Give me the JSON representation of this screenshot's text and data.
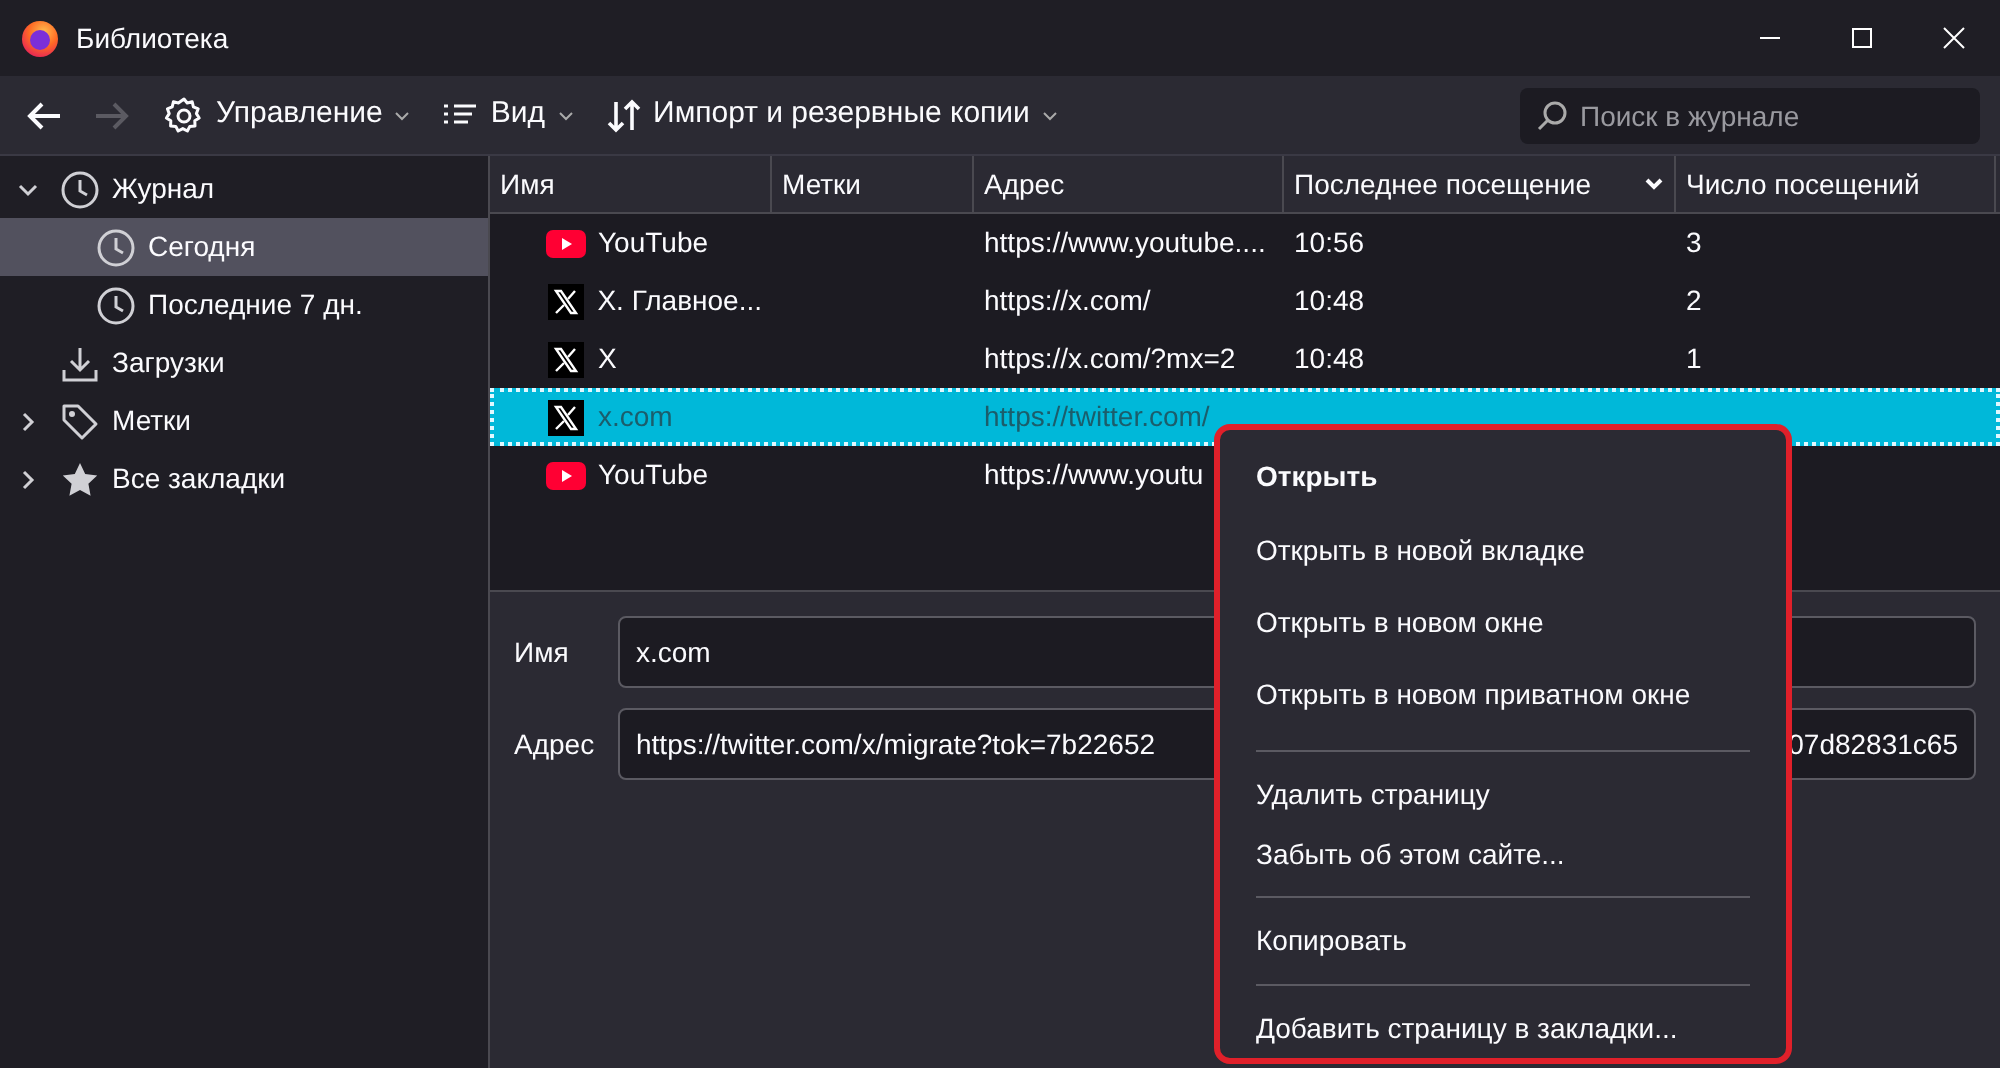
{
  "window": {
    "title": "Библиотека"
  },
  "toolbar": {
    "back_disabled": false,
    "forward_disabled": true,
    "menus": [
      {
        "kind": "gear",
        "label": "Управление"
      },
      {
        "kind": "list",
        "label": "Вид"
      },
      {
        "kind": "sort",
        "label": "Импорт и резервные копии"
      }
    ],
    "search": {
      "placeholder": "Поиск в журнале"
    }
  },
  "sidebar": {
    "items": [
      {
        "kind": "clock",
        "label": "Журнал",
        "expanded": true,
        "selected": false,
        "children": [
          {
            "kind": "clock",
            "label": "Сегодня",
            "selected": true
          },
          {
            "kind": "clock",
            "label": "Последние 7 дн.",
            "selected": false
          }
        ]
      },
      {
        "kind": "download",
        "label": "Загрузки",
        "selected": false
      },
      {
        "kind": "tag",
        "label": "Метки",
        "expanded": false,
        "selected": false
      },
      {
        "kind": "star",
        "label": "Все закладки",
        "expanded": false,
        "selected": false
      }
    ]
  },
  "table": {
    "columns": [
      {
        "label": "Имя",
        "sorted": false
      },
      {
        "label": "Метки",
        "sorted": false
      },
      {
        "label": "Адрес",
        "sorted": false
      },
      {
        "label": "Последнее посещение",
        "sorted": true
      },
      {
        "label": "Число посещений",
        "sorted": false
      }
    ],
    "rows": [
      {
        "kind": "youtube",
        "name": "YouTube",
        "address": "https://www.youtube....",
        "last_visit": "10:56",
        "visits": "3",
        "selected": false
      },
      {
        "kind": "x",
        "name": "X. Главное...",
        "address": "https://x.com/",
        "last_visit": "10:48",
        "visits": "2",
        "selected": false
      },
      {
        "kind": "x",
        "name": "X",
        "address": "https://x.com/?mx=2",
        "last_visit": "10:48",
        "visits": "1",
        "selected": false
      },
      {
        "kind": "x",
        "name": "x.com",
        "address": "https://twitter.com/",
        "selected": true
      },
      {
        "kind": "youtube",
        "name": "YouTube",
        "address": "https://www.youtu",
        "selected": false
      }
    ]
  },
  "details": {
    "fields": [
      {
        "label": "Имя",
        "value": "x.com"
      },
      {
        "label": "Адрес",
        "value": "https://twitter.com/x/migrate?tok=7b22652",
        "value_end": "07d82831c65"
      }
    ]
  },
  "context_menu": {
    "items": [
      {
        "label": "Открыть",
        "default": true,
        "separator_before": false
      },
      {
        "label": "Открыть в новой вкладке",
        "default": false,
        "separator_before": false
      },
      {
        "label": "Открыть в новом окне",
        "default": false,
        "separator_before": false
      },
      {
        "label": "Открыть в новом приватном окне",
        "default": false,
        "separator_before": false
      },
      {
        "label": "Удалить страницу",
        "default": false,
        "separator_before": true
      },
      {
        "label": "Забыть об этом сайте...",
        "default": false,
        "separator_before": false
      },
      {
        "label": "Копировать",
        "default": false,
        "separator_before": true
      },
      {
        "label": "Добавить страницу в закладки...",
        "default": false,
        "separator_before": true
      }
    ]
  }
}
